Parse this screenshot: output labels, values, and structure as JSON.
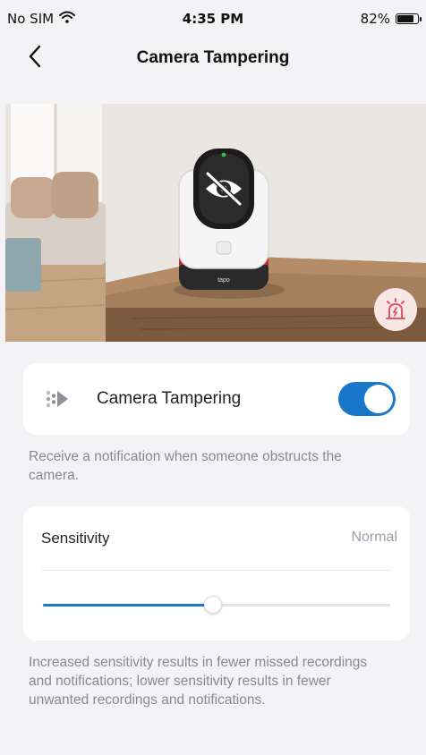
{
  "status_bar": {
    "carrier": "No SIM",
    "time": "4:35 PM",
    "battery_percent": "82%",
    "battery_level": 0.82
  },
  "nav": {
    "title": "Camera Tampering",
    "back_icon": "chevron-left-icon"
  },
  "hero": {
    "camera_brand": "tapo",
    "alarm_icon": "alarm-siren-icon",
    "obstruction_icon": "eye-slash-icon"
  },
  "tamper": {
    "label": "Camera Tampering",
    "enabled": true,
    "description": "Receive a notification when someone obstructs the camera."
  },
  "sensitivity": {
    "label": "Sensitivity",
    "value": "Normal",
    "level": 0.49,
    "description": "Increased sensitivity results in fewer missed recordings and notifications; lower sensitivity results in fewer unwanted recordings and notifications."
  },
  "colors": {
    "accent": "#1977ca",
    "background": "#f3f3f5",
    "alarm": "#e0556a"
  }
}
